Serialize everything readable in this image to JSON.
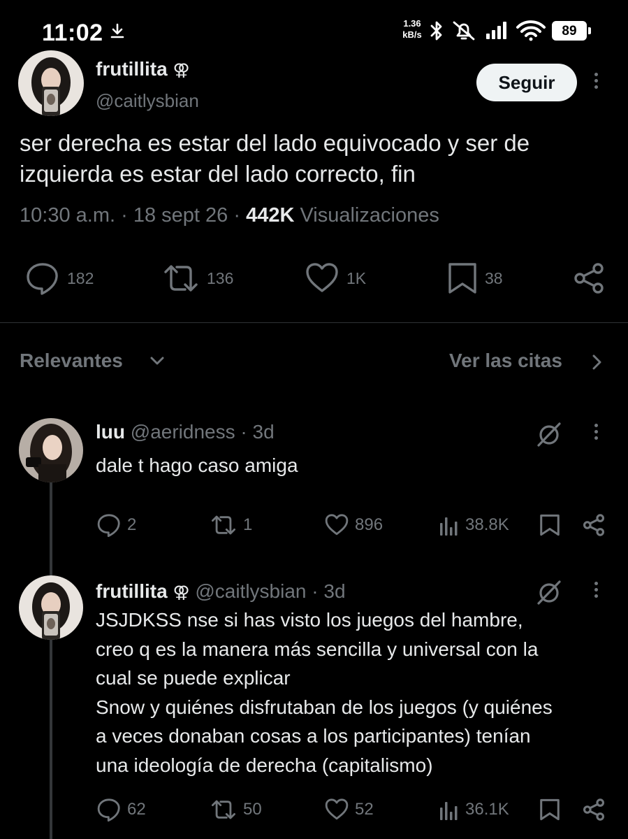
{
  "status_bar": {
    "time": "11:02",
    "net_speed_value": "1.36",
    "net_speed_unit": "kB/s",
    "battery": "89"
  },
  "tweet": {
    "display_name": "frutillita",
    "name_glyph": "⚢",
    "handle": "@caitlysbian",
    "follow_label": "Seguir",
    "text": "ser derecha es estar del lado equivocado y ser de izquierda es estar del lado correcto, fin",
    "time": "10:30 a.m.",
    "sep": "·",
    "date": "18 sept 26",
    "views_count": "442K",
    "views_label": "Visualizaciones",
    "replies": "182",
    "retweets": "136",
    "likes": "1K",
    "bookmarks": "38"
  },
  "sort": {
    "label": "Relevantes",
    "quotes_label": "Ver las citas"
  },
  "replies": [
    {
      "display_name": "luu",
      "name_glyph": "",
      "handle": "@aeridness",
      "age": "· 3d",
      "lines": [
        "dale t hago caso amiga"
      ],
      "replies": "2",
      "retweets": "1",
      "likes": "896",
      "views": "38.8K"
    },
    {
      "display_name": "frutillita",
      "name_glyph": "⚢",
      "handle": "@caitlysbian",
      "age": "· 3d",
      "lines": [
        "JSJDKSS nse si has visto los juegos del hambre,",
        "creo q es la manera más sencilla y universal con la",
        "cual se puede explicar",
        "Snow y quiénes disfrutaban de los juegos (y quiénes",
        "a veces donaban cosas a los participantes) tenían",
        "una ideología de derecha (capitalismo)"
      ],
      "replies": "62",
      "retweets": "50",
      "likes": "52",
      "views": "36.1K"
    }
  ],
  "colors": {
    "background": "#000000",
    "text": "#e7e9ea",
    "secondary": "#71767b",
    "follow_button": "#eff3f4",
    "divider": "#2f3336"
  }
}
